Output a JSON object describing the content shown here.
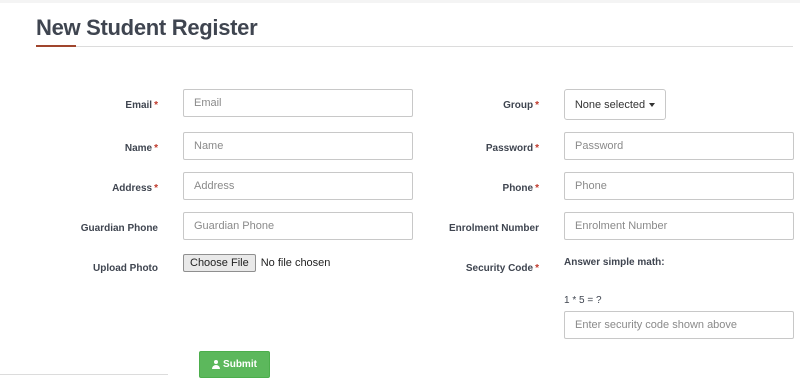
{
  "page": {
    "title": "New Student Register"
  },
  "form": {
    "required_mark": "*",
    "email": {
      "label": "Email",
      "placeholder": "Email"
    },
    "name": {
      "label": "Name",
      "placeholder": "Name"
    },
    "address": {
      "label": "Address",
      "placeholder": "Address"
    },
    "guardian_phone": {
      "label": "Guardian Phone",
      "placeholder": "Guardian Phone"
    },
    "upload_photo": {
      "label": "Upload Photo",
      "button_label": "Choose File",
      "status": "No file chosen"
    },
    "group": {
      "label": "Group",
      "selected": "None selected"
    },
    "password": {
      "label": "Password",
      "placeholder": "Password"
    },
    "phone": {
      "label": "Phone",
      "placeholder": "Phone"
    },
    "enrolment_number": {
      "label": "Enrolment Number",
      "placeholder": "Enrolment Number"
    },
    "security_code": {
      "label": "Security Code",
      "instruction": "Answer simple math:",
      "question": "1 * 5 = ?",
      "placeholder": "Enter security code shown above"
    },
    "submit": {
      "label": "Submit",
      "icon": "user-icon"
    }
  },
  "colors": {
    "accent": "#a0452d",
    "required": "#c0392b",
    "submit": "#5cb85c"
  }
}
